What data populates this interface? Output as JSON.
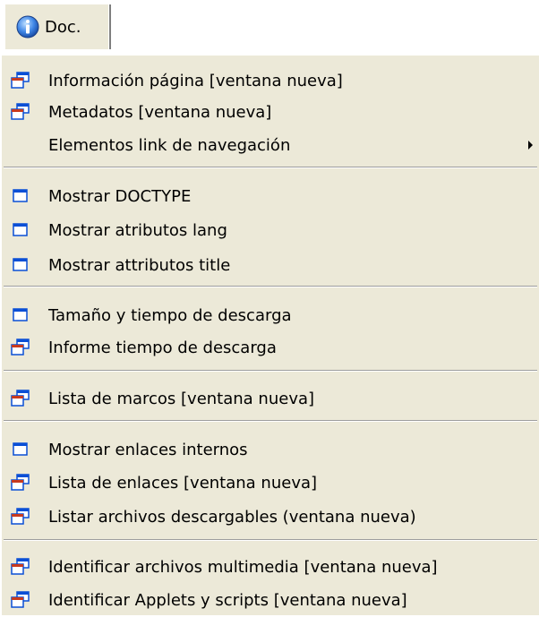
{
  "toolbar": {
    "doc_label": "Doc."
  },
  "menu": {
    "groups": [
      [
        {
          "label": "Información página [ventana nueva]",
          "icon": "new-window-icon"
        },
        {
          "label": "Metadatos [ventana nueva]",
          "icon": "new-window-icon"
        },
        {
          "label": "Elementos link de navegación",
          "icon": "",
          "submenu": true
        }
      ],
      [
        {
          "label": "Mostrar DOCTYPE",
          "icon": "window-icon"
        },
        {
          "label": "Mostrar atributos lang",
          "icon": "window-icon"
        },
        {
          "label": "Mostrar attributos title",
          "icon": "window-icon"
        }
      ],
      [
        {
          "label": "Tamaño y tiempo de descarga",
          "icon": "window-icon"
        },
        {
          "label": "Informe tiempo de descarga",
          "icon": "new-window-icon"
        }
      ],
      [
        {
          "label": "Lista de marcos [ventana nueva]",
          "icon": "new-window-icon"
        }
      ],
      [
        {
          "label": "Mostrar enlaces internos",
          "icon": "window-icon"
        },
        {
          "label": "Lista de enlaces [ventana nueva]",
          "icon": "new-window-icon"
        },
        {
          "label": "Listar archivos descargables (ventana nueva)",
          "icon": "new-window-icon"
        }
      ],
      [
        {
          "label": "Identificar archivos multimedia [ventana nueva]",
          "icon": "new-window-icon"
        },
        {
          "label": "Identificar Applets y scripts [ventana nueva]",
          "icon": "new-window-icon"
        }
      ]
    ]
  },
  "colors": {
    "menu_bg": "#ece9d8",
    "window_title_blue": "#0a4fd6",
    "window_title_red": "#c83a1e"
  }
}
